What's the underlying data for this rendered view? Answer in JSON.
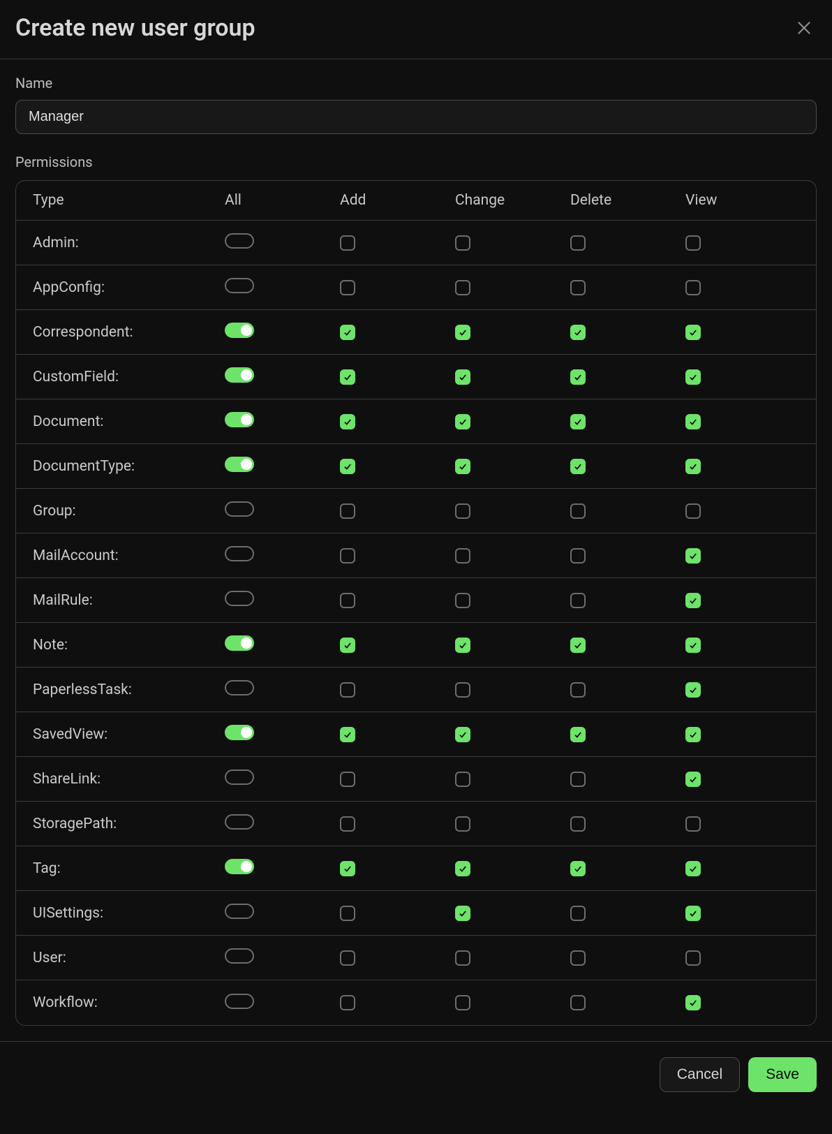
{
  "modal": {
    "title": "Create new user group",
    "name_label": "Name",
    "name_value": "Manager",
    "permissions_label": "Permissions",
    "cancel_label": "Cancel",
    "save_label": "Save"
  },
  "headers": {
    "type": "Type",
    "all": "All",
    "add": "Add",
    "change": "Change",
    "delete": "Delete",
    "view": "View"
  },
  "permissions": [
    {
      "label": "Admin:",
      "all": false,
      "add": false,
      "change": false,
      "delete": false,
      "view": false
    },
    {
      "label": "AppConfig:",
      "all": false,
      "add": false,
      "change": false,
      "delete": false,
      "view": false
    },
    {
      "label": "Correspondent:",
      "all": true,
      "add": true,
      "change": true,
      "delete": true,
      "view": true
    },
    {
      "label": "CustomField:",
      "all": true,
      "add": true,
      "change": true,
      "delete": true,
      "view": true
    },
    {
      "label": "Document:",
      "all": true,
      "add": true,
      "change": true,
      "delete": true,
      "view": true
    },
    {
      "label": "DocumentType:",
      "all": true,
      "add": true,
      "change": true,
      "delete": true,
      "view": true
    },
    {
      "label": "Group:",
      "all": false,
      "add": false,
      "change": false,
      "delete": false,
      "view": false
    },
    {
      "label": "MailAccount:",
      "all": false,
      "add": false,
      "change": false,
      "delete": false,
      "view": true
    },
    {
      "label": "MailRule:",
      "all": false,
      "add": false,
      "change": false,
      "delete": false,
      "view": true
    },
    {
      "label": "Note:",
      "all": true,
      "add": true,
      "change": true,
      "delete": true,
      "view": true
    },
    {
      "label": "PaperlessTask:",
      "all": false,
      "add": false,
      "change": false,
      "delete": false,
      "view": true
    },
    {
      "label": "SavedView:",
      "all": true,
      "add": true,
      "change": true,
      "delete": true,
      "view": true
    },
    {
      "label": "ShareLink:",
      "all": false,
      "add": false,
      "change": false,
      "delete": false,
      "view": true
    },
    {
      "label": "StoragePath:",
      "all": false,
      "add": false,
      "change": false,
      "delete": false,
      "view": false
    },
    {
      "label": "Tag:",
      "all": true,
      "add": true,
      "change": true,
      "delete": true,
      "view": true
    },
    {
      "label": "UISettings:",
      "all": false,
      "add": false,
      "change": true,
      "delete": false,
      "view": true
    },
    {
      "label": "User:",
      "all": false,
      "add": false,
      "change": false,
      "delete": false,
      "view": false
    },
    {
      "label": "Workflow:",
      "all": false,
      "add": false,
      "change": false,
      "delete": false,
      "view": true
    }
  ]
}
